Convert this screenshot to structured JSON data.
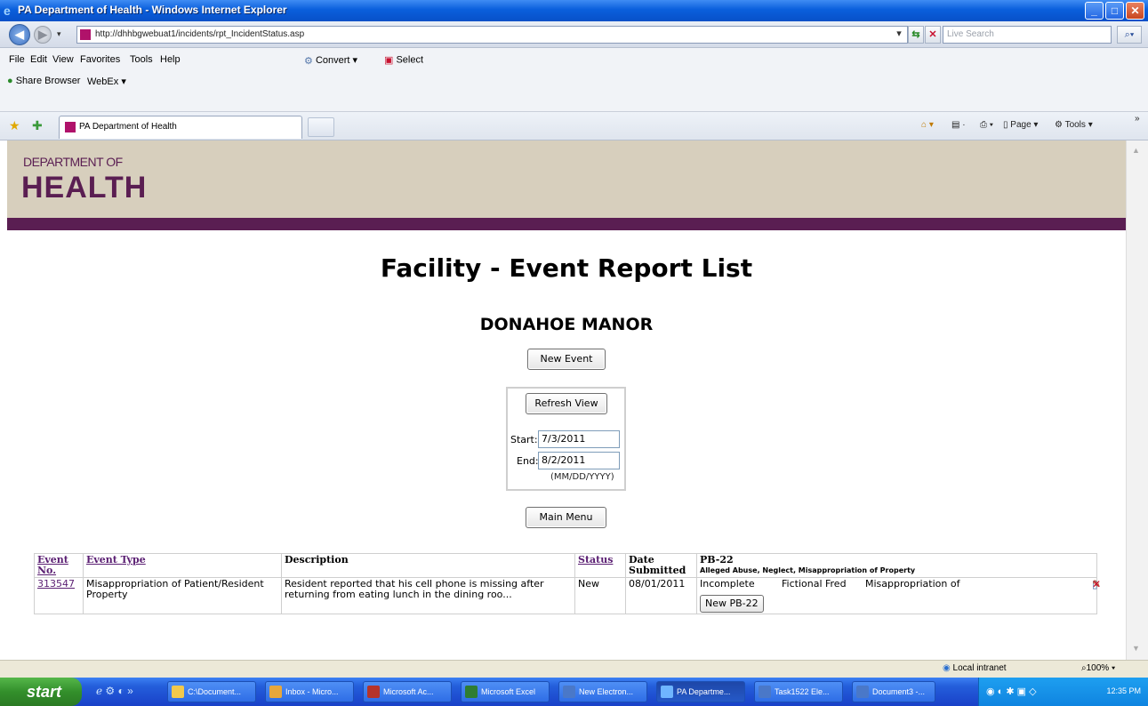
{
  "window": {
    "title": "PA Department of Health - Windows Internet Explorer"
  },
  "address_bar": {
    "url": "http://dhhbgwebuat1/incidents/rpt_IncidentStatus.asp",
    "search_placeholder": "Live Search"
  },
  "menu": {
    "items": [
      "File",
      "Edit",
      "View",
      "Favorites",
      "Tools",
      "Help"
    ],
    "convert_label": "Convert",
    "select_label": "Select",
    "share_browser_label": "Share Browser",
    "webex_label": "WebEx"
  },
  "tab": {
    "label": "PA Department of Health"
  },
  "command_bar": {
    "page_label": "Page",
    "tools_label": "Tools"
  },
  "banner": {
    "logo_line1": "DEPARTMENT OF",
    "logo_line2": "HEALTH",
    "colors": {
      "banner_bg": "#d7cfbd",
      "purple": "#5a1e52"
    }
  },
  "page": {
    "title": "Facility - Event Report List",
    "facility_name": "DONAHOE MANOR",
    "new_event_label": "New Event",
    "refresh_view_label": "Refresh View",
    "start_label": "Start:",
    "start_value": "7/3/2011",
    "end_label": "End:",
    "end_value": "8/2/2011",
    "date_format_hint": "(MM/DD/YYYY)",
    "main_menu_label": "Main Menu"
  },
  "table": {
    "headers": {
      "event_no": "Event No.",
      "event_type": "Event Type",
      "description": "Description",
      "status": "Status",
      "date_submitted": "Date Submitted",
      "pb22": "PB-22",
      "pb22_sub": "Alleged Abuse, Neglect, Misappropriation of Property"
    },
    "rows": [
      {
        "event_no": "313547",
        "event_type": "Misappropriation of Patient/Resident Property",
        "description": "Resident reported that his cell phone is missing after returning from eating lunch in the dining roo...",
        "status": "New",
        "date_submitted": "08/01/2011",
        "pb22_status": "Incomplete",
        "pb22_person": "Fictional Fred",
        "pb22_type": "Misappropriation of",
        "new_pb22_label": "New PB-22"
      }
    ]
  },
  "status_bar": {
    "zone": "Local intranet",
    "zoom": "100%"
  },
  "taskbar": {
    "start_label": "start",
    "tasks": [
      "C:\\Document...",
      "Inbox - Micro...",
      "Microsoft Ac...",
      "Microsoft Excel",
      "New Electron...",
      "PA Departme...",
      "Task1522 Ele...",
      "Document3 -..."
    ],
    "clock": "12:35 PM"
  }
}
